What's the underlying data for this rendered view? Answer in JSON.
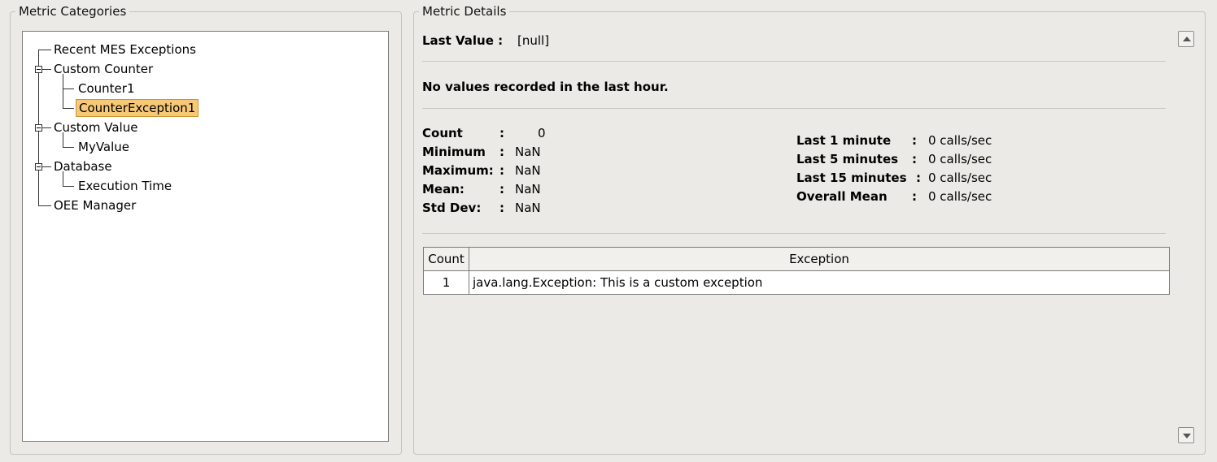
{
  "left_panel": {
    "legend": "Metric Categories",
    "tree": [
      {
        "label": "Recent MES Exceptions"
      },
      {
        "label": "Custom Counter",
        "expanded": true
      },
      {
        "label": "Counter1"
      },
      {
        "label": "CounterException1",
        "selected": true
      },
      {
        "label": "Custom Value",
        "expanded": true
      },
      {
        "label": "MyValue"
      },
      {
        "label": "Database",
        "expanded": true
      },
      {
        "label": "Execution Time"
      },
      {
        "label": "OEE Manager"
      }
    ]
  },
  "details": {
    "legend": "Metric Details",
    "last_value_label": "Last Value :",
    "last_value": "[null]",
    "no_values_message": "No values recorded in the last hour.",
    "stats": [
      {
        "label": "Count",
        "value": "0"
      },
      {
        "label": "Minimum",
        "value": "NaN"
      },
      {
        "label": "Maximum:",
        "value": "NaN"
      },
      {
        "label": "Mean:",
        "value": "NaN"
      },
      {
        "label": "Std Dev:",
        "value": "NaN"
      }
    ],
    "rates": [
      {
        "label": "Last 1 minute",
        "value": "0 calls/sec"
      },
      {
        "label": "Last 5 minutes",
        "value": "0 calls/sec"
      },
      {
        "label": "Last 15 minutes",
        "value": "0 calls/sec"
      },
      {
        "label": "Overall Mean",
        "value": "0 calls/sec"
      }
    ],
    "colon": ":",
    "table": {
      "headers": [
        "Count",
        "Exception"
      ],
      "rows": [
        {
          "count": "1",
          "exception": "java.lang.Exception: This is a custom exception"
        }
      ]
    }
  }
}
